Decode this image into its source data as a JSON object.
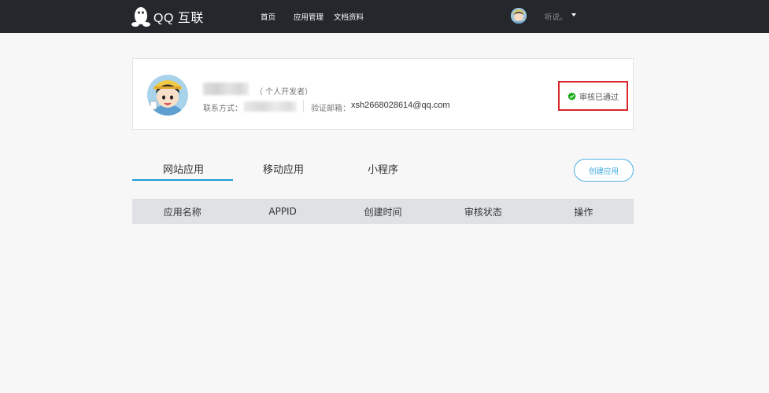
{
  "header": {
    "logo_text": "QQ 互联",
    "nav": [
      {
        "label": "首页"
      },
      {
        "label": "应用管理"
      },
      {
        "label": "文档资料"
      }
    ],
    "user_name": "听说。"
  },
  "profile": {
    "developer_type": "（ 个人开发者）",
    "contact_label": "联系方式：",
    "email_label": "验证邮箱：",
    "email_value": "xsh2668028614@qq.com",
    "status": {
      "text": "审核已通过",
      "color": "#1aad19",
      "highlight_color": "#d9262b"
    }
  },
  "tabs": [
    {
      "label": "网站应用",
      "active": true
    },
    {
      "label": "移动应用",
      "active": false
    },
    {
      "label": "小程序",
      "active": false
    }
  ],
  "create_button": "创建应用",
  "table": {
    "columns": [
      "应用名称",
      "APPID",
      "创建时间",
      "审核状态",
      "操作"
    ]
  },
  "colors": {
    "topbar": "#24272c",
    "accent": "#1d9bd8",
    "table_header": "#dfe1e4"
  },
  "icons": [
    "qq-penguin-icon",
    "user-avatar",
    "caret-down-icon",
    "verified-check-icon"
  ]
}
